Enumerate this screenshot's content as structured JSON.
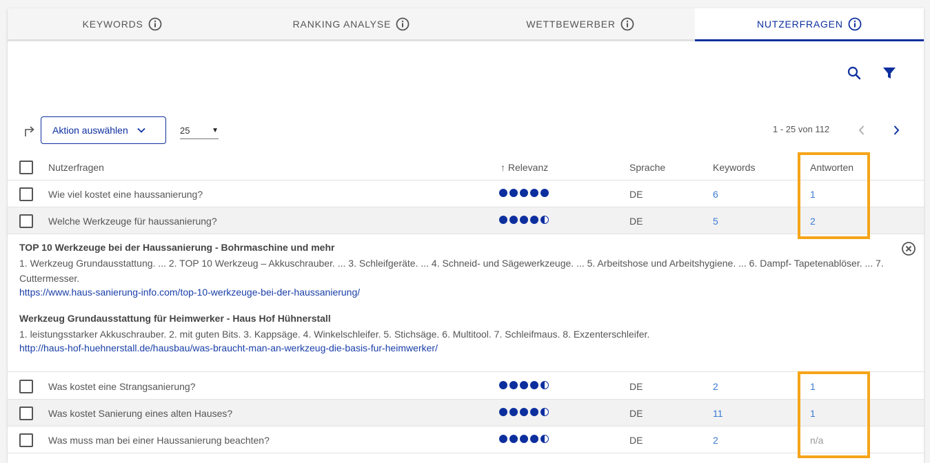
{
  "tabs": [
    {
      "label": "KEYWORDS",
      "active": false
    },
    {
      "label": "RANKING ANALYSE",
      "active": false
    },
    {
      "label": "WETTBEWERBER",
      "active": false
    },
    {
      "label": "NUTZERFRAGEN",
      "active": true
    }
  ],
  "toolbar": {
    "search_icon": "search-icon",
    "filter_icon": "filter-icon"
  },
  "actions": {
    "select_label": "Aktion auswählen",
    "per_page": "25"
  },
  "pagination": {
    "label": "1 - 25 von 112"
  },
  "table": {
    "headers": {
      "question": "Nutzerfragen",
      "relevance": "Relevanz",
      "language": "Sprache",
      "keywords": "Keywords",
      "answers": "Antworten"
    },
    "rows": [
      {
        "question": "Wie viel kostet eine haussanierung?",
        "relevance": 5,
        "language": "DE",
        "keywords": "6",
        "answers": "1"
      },
      {
        "question": "Welche Werkzeuge für haussanierung?",
        "relevance": 4.5,
        "language": "DE",
        "keywords": "5",
        "answers": "2"
      },
      {
        "question": "Was kostet eine Strangsanierung?",
        "relevance": 4.5,
        "language": "DE",
        "keywords": "2",
        "answers": "1"
      },
      {
        "question": "Was kostet Sanierung eines alten Hauses?",
        "relevance": 4.5,
        "language": "DE",
        "keywords": "11",
        "answers": "1"
      },
      {
        "question": "Was muss man bei einer Haussanierung beachten?",
        "relevance": 4.5,
        "language": "DE",
        "keywords": "2",
        "answers": "n/a"
      }
    ]
  },
  "expanded": {
    "answers": [
      {
        "title": "TOP 10 Werkzeuge bei der Haussanierung - Bohrmaschine und mehr",
        "text": "1. Werkzeug Grundausstattung. ... 2. TOP 10 Werkzeug – Akkuschrauber. ... 3. Schleifgeräte. ... 4. Schneid- und Sägewerkzeuge. ... 5. Arbeitshose und Arbeitshygiene. ... 6. Dampf- Tapetenablöser. ... 7. Cuttermesser.",
        "url": "https://www.haus-sanierung-info.com/top-10-werkzeuge-bei-der-haussanierung/"
      },
      {
        "title": "Werkzeug Grundausstattung für Heimwerker - Haus Hof Hühnerstall",
        "text": "1. leistungsstarker Akkuschrauber. 2. mit guten Bits. 3. Kappsäge. 4. Winkelschleifer. 5. Stichsäge. 6. Multitool. 7. Schleifmaus. 8. Exzenterschleifer.",
        "url": "http://haus-hof-huehnerstall.de/hausbau/was-braucht-man-an-werkzeug-die-basis-fur-heimwerker/"
      }
    ]
  },
  "colors": {
    "accent": "#0d2f9e",
    "link": "#3a7bd5",
    "highlight": "#f5a418"
  }
}
